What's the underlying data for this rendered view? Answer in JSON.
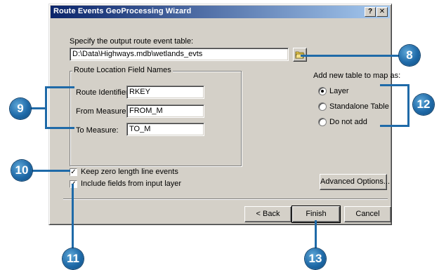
{
  "window": {
    "title": "Route Events GeoProcessing Wizard",
    "help_button": "?",
    "close_button": "✕"
  },
  "output": {
    "label": "Specify the output route event table:",
    "value": "D:\\Data\\Highways.mdb\\wetlands_evts"
  },
  "route_fields": {
    "legend": "Route Location Field Names",
    "route_identifier_label": "Route Identifier:",
    "route_identifier_value": "RKEY",
    "from_measure_label": "From Measure:",
    "from_measure_value": "FROM_M",
    "to_measure_label": "To Measure:",
    "to_measure_value": "TO_M"
  },
  "add_to_map": {
    "label": "Add new table to map as:",
    "options": [
      {
        "label": "Layer",
        "selected": true
      },
      {
        "label": "Standalone Table",
        "selected": false
      },
      {
        "label": "Do not add",
        "selected": false
      }
    ]
  },
  "options": {
    "keep_zero_label": "Keep zero length line events",
    "keep_zero_checked": true,
    "include_fields_label": "Include fields from input layer",
    "include_fields_checked": true
  },
  "buttons": {
    "advanced": "Advanced Options...",
    "back": "< Back",
    "finish": "Finish",
    "cancel": "Cancel"
  },
  "callouts": {
    "c8": "8",
    "c9": "9",
    "c10": "10",
    "c11": "11",
    "c12": "12",
    "c13": "13"
  },
  "colors": {
    "callout": "#1f6aa8",
    "titlebar_start": "#0a246a",
    "titlebar_end": "#a6caf0",
    "dialog_face": "#d4d0c8"
  }
}
